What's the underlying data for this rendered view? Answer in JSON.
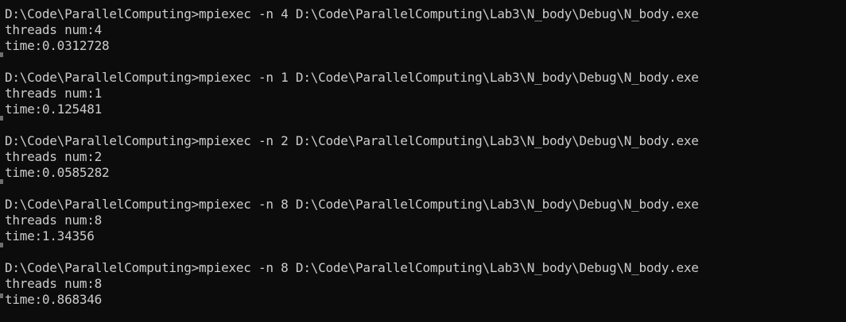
{
  "console": {
    "lines": [
      "D:\\Code\\ParallelComputing>mpiexec -n 4 D:\\Code\\ParallelComputing\\Lab3\\N_body\\Debug\\N_body.exe",
      "threads num:4",
      "time:0.0312728",
      "",
      "D:\\Code\\ParallelComputing>mpiexec -n 1 D:\\Code\\ParallelComputing\\Lab3\\N_body\\Debug\\N_body.exe",
      "threads num:1",
      "time:0.125481",
      "",
      "D:\\Code\\ParallelComputing>mpiexec -n 2 D:\\Code\\ParallelComputing\\Lab3\\N_body\\Debug\\N_body.exe",
      "threads num:2",
      "time:0.0585282",
      "",
      "D:\\Code\\ParallelComputing>mpiexec -n 8 D:\\Code\\ParallelComputing\\Lab3\\N_body\\Debug\\N_body.exe",
      "threads num:8",
      "time:1.34356",
      "",
      "D:\\Code\\ParallelComputing>mpiexec -n 8 D:\\Code\\ParallelComputing\\Lab3\\N_body\\Debug\\N_body.exe",
      "threads num:8",
      "time:0.868346"
    ]
  }
}
